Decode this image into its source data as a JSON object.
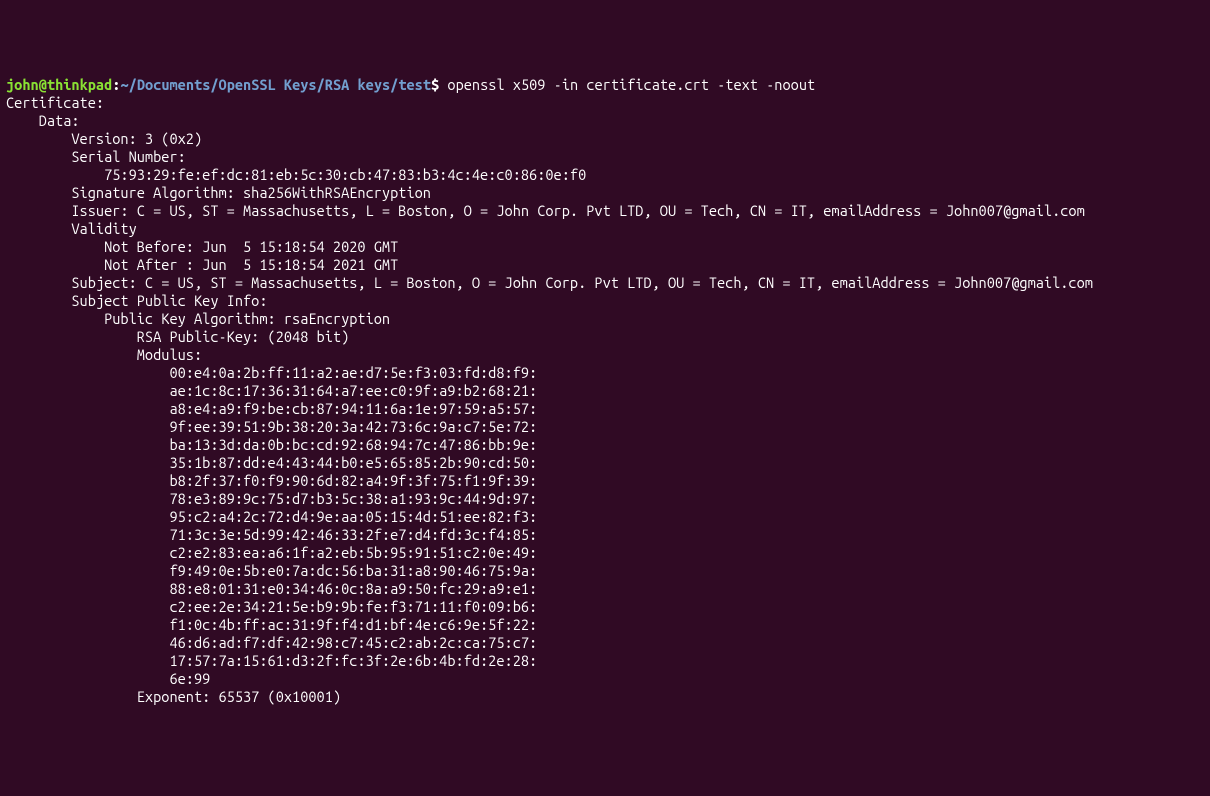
{
  "prompt": {
    "user": "john",
    "at": "@",
    "host": "thinkpad",
    "colon": ":",
    "path": "~/Documents/OpenSSL Keys/RSA keys/test",
    "dollar": "$",
    "command": "openssl x509 -in certificate.crt -text -noout"
  },
  "output": {
    "l0": "Certificate:",
    "l1": "    Data:",
    "l2": "        Version: 3 (0x2)",
    "l3": "        Serial Number:",
    "l4": "            75:93:29:fe:ef:dc:81:eb:5c:30:cb:47:83:b3:4c:4e:c0:86:0e:f0",
    "l5": "        Signature Algorithm: sha256WithRSAEncryption",
    "l6": "        Issuer: C = US, ST = Massachusetts, L = Boston, O = John Corp. Pvt LTD, OU = Tech, CN = IT, emailAddress = John007@gmail.com",
    "l7": "        Validity",
    "l8": "            Not Before: Jun  5 15:18:54 2020 GMT",
    "l9": "            Not After : Jun  5 15:18:54 2021 GMT",
    "l10": "        Subject: C = US, ST = Massachusetts, L = Boston, O = John Corp. Pvt LTD, OU = Tech, CN = IT, emailAddress = John007@gmail.com",
    "l11": "        Subject Public Key Info:",
    "l12": "            Public Key Algorithm: rsaEncryption",
    "l13": "                RSA Public-Key: (2048 bit)",
    "l14": "                Modulus:",
    "l15": "                    00:e4:0a:2b:ff:11:a2:ae:d7:5e:f3:03:fd:d8:f9:",
    "l16": "                    ae:1c:8c:17:36:31:64:a7:ee:c0:9f:a9:b2:68:21:",
    "l17": "                    a8:e4:a9:f9:be:cb:87:94:11:6a:1e:97:59:a5:57:",
    "l18": "                    9f:ee:39:51:9b:38:20:3a:42:73:6c:9a:c7:5e:72:",
    "l19": "                    ba:13:3d:da:0b:bc:cd:92:68:94:7c:47:86:bb:9e:",
    "l20": "                    35:1b:87:dd:e4:43:44:b0:e5:65:85:2b:90:cd:50:",
    "l21": "                    b8:2f:37:f0:f9:90:6d:82:a4:9f:3f:75:f1:9f:39:",
    "l22": "                    78:e3:89:9c:75:d7:b3:5c:38:a1:93:9c:44:9d:97:",
    "l23": "                    95:c2:a4:2c:72:d4:9e:aa:05:15:4d:51:ee:82:f3:",
    "l24": "                    71:3c:3e:5d:99:42:46:33:2f:e7:d4:fd:3c:f4:85:",
    "l25": "                    c2:e2:83:ea:a6:1f:a2:eb:5b:95:91:51:c2:0e:49:",
    "l26": "                    f9:49:0e:5b:e0:7a:dc:56:ba:31:a8:90:46:75:9a:",
    "l27": "                    88:e8:01:31:e0:34:46:0c:8a:a9:50:fc:29:a9:e1:",
    "l28": "                    c2:ee:2e:34:21:5e:b9:9b:fe:f3:71:11:f0:09:b6:",
    "l29": "                    f1:0c:4b:ff:ac:31:9f:f4:d1:bf:4e:c6:9e:5f:22:",
    "l30": "                    46:d6:ad:f7:df:42:98:c7:45:c2:ab:2c:ca:75:c7:",
    "l31": "                    17:57:7a:15:61:d3:2f:fc:3f:2e:6b:4b:fd:2e:28:",
    "l32": "                    6e:99",
    "l33": "                Exponent: 65537 (0x10001)"
  }
}
